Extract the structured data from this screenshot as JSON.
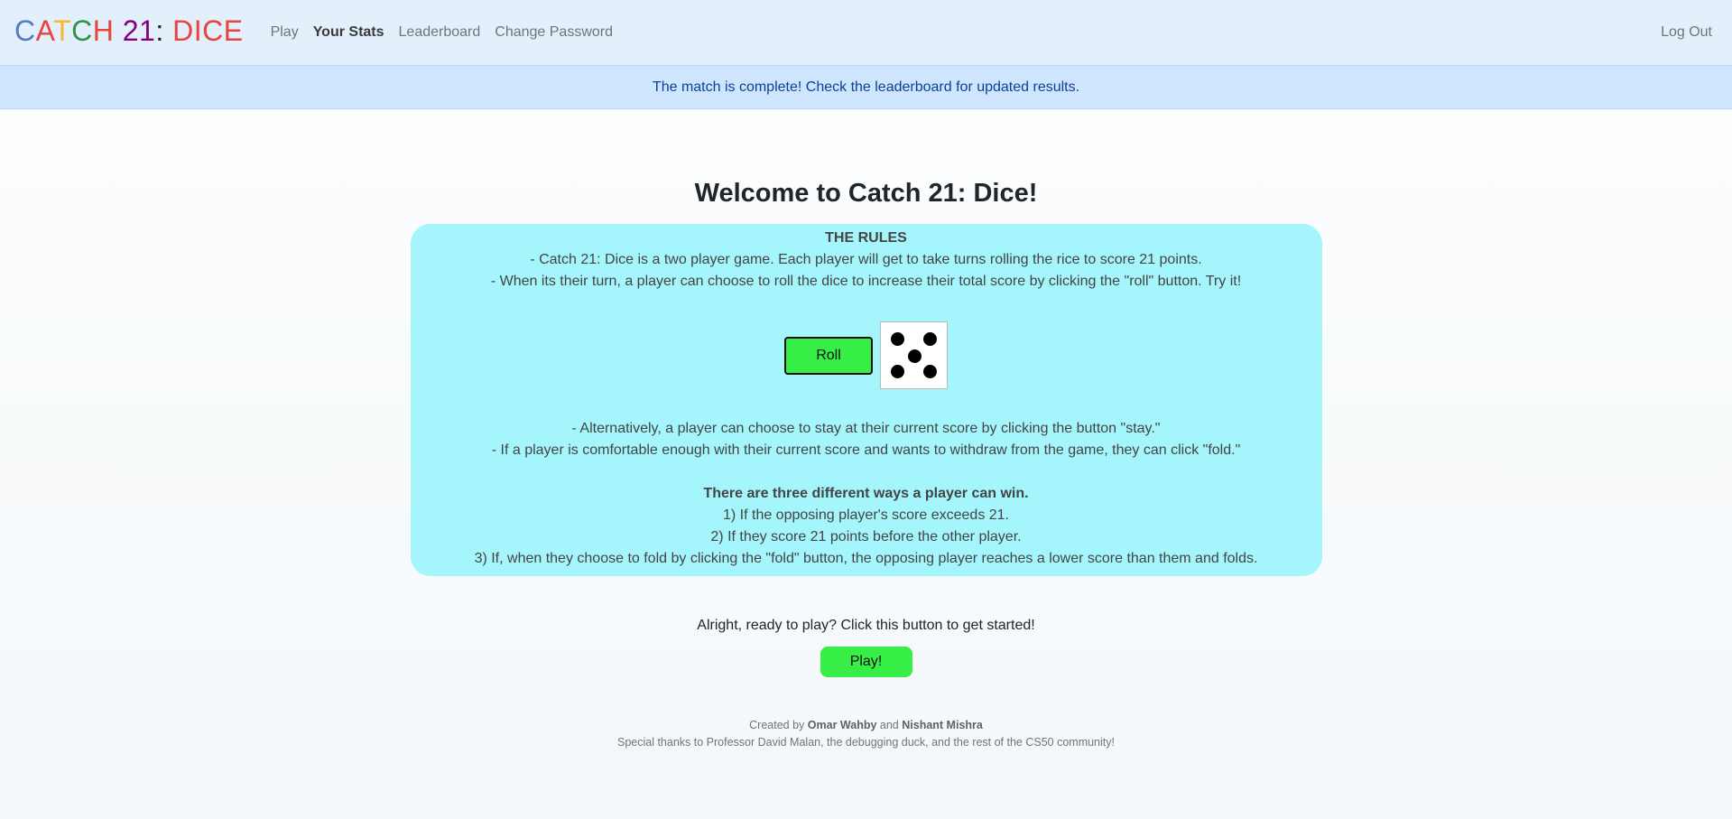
{
  "nav": {
    "brand_letters": [
      "C",
      "A",
      "T",
      "C",
      "H",
      " ",
      "2",
      "1",
      ":",
      " ",
      "D",
      "I",
      "C",
      "E"
    ],
    "links": [
      "Play",
      "Your Stats",
      "Leaderboard",
      "Change Password"
    ],
    "logout": "Log Out"
  },
  "alert": "The match is complete! Check the leaderboard for updated results.",
  "main": {
    "title": "Welcome to Catch 21: Dice!",
    "rules": {
      "heading": "THE RULES",
      "line1": "- Catch 21: Dice is a two player game. Each player will get to take turns rolling the rice to score 21 points.",
      "line2": "- When its their turn, a player can choose to roll the dice to increase their total score by clicking the \"roll\" button. Try it!",
      "roll_label": "Roll",
      "die_value": 5,
      "line3": "- Alternatively, a player can choose to stay at their current score by clicking the button \"stay.\"",
      "line4": "- If a player is comfortable enough with their current score and wants to withdraw from the game, they can click \"fold.\"",
      "win_heading": "There are three different ways a player can win.",
      "win1": "1) If the opposing player's score exceeds 21.",
      "win2": "2) If they score 21 points before the other player.",
      "win3": "3) If, when they choose to fold by clicking the \"fold\" button, the opposing player reaches a lower score than them and folds."
    },
    "ready": "Alright, ready to play? Click this button to get started!",
    "play_label": "Play!"
  },
  "footer": {
    "created_by": "Created by",
    "author1": "Omar Wahby",
    "and": "and",
    "author2": "Nishant Mishra",
    "thanks": "Special thanks to Professor David Malan, the debugging duck, and the rest of the CS50 community!"
  },
  "colors": {
    "accent_green": "#36ee45",
    "rules_bg": "#a4f5fc",
    "alert_bg": "#cfe5fd",
    "navbar_bg": "#e3f0fb"
  }
}
